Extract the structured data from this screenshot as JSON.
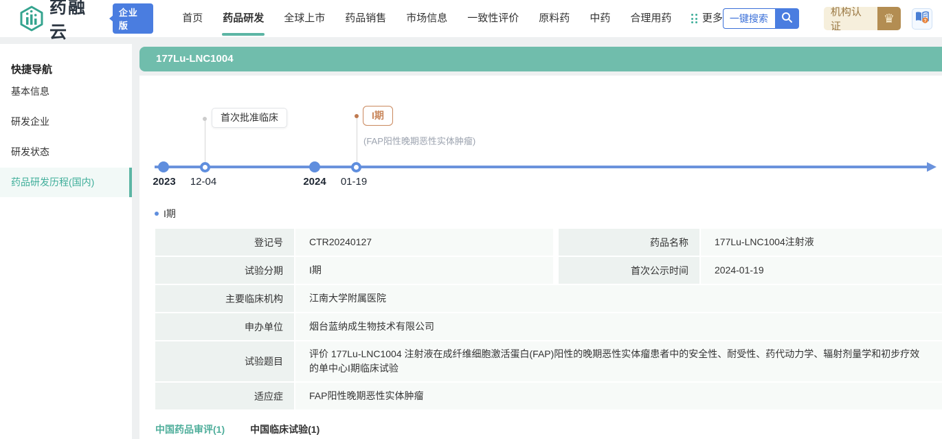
{
  "brand": {
    "name": "药融云",
    "edition": "企业版"
  },
  "nav": {
    "items": [
      {
        "label": "首页",
        "active": false
      },
      {
        "label": "药品研发",
        "active": true
      },
      {
        "label": "全球上市",
        "active": false
      },
      {
        "label": "药品销售",
        "active": false
      },
      {
        "label": "市场信息",
        "active": false
      },
      {
        "label": "一致性评价",
        "active": false
      },
      {
        "label": "原料药",
        "active": false
      },
      {
        "label": "中药",
        "active": false
      },
      {
        "label": "合理用药",
        "active": false
      }
    ],
    "more_label": "更多"
  },
  "search": {
    "placeholder": "一键搜索"
  },
  "header_right": {
    "cert_label": "机构认证"
  },
  "sidebar": {
    "title": "快捷导航",
    "items": [
      {
        "label": "基本信息",
        "active": false
      },
      {
        "label": "研发企业",
        "active": false
      },
      {
        "label": "研发状态",
        "active": false
      },
      {
        "label": "药品研发历程(国内)",
        "active": true
      }
    ]
  },
  "main": {
    "title": "177Lu-LNC1004",
    "timeline": {
      "points": [
        {
          "date": "2023",
          "type": "year"
        },
        {
          "date": "12-04",
          "type": "event"
        },
        {
          "date": "2024",
          "type": "year"
        },
        {
          "date": "01-19",
          "type": "event"
        }
      ],
      "events": [
        {
          "label": "首次批准临床"
        },
        {
          "label": "I期",
          "sublabel": "(FAP阳性晚期恶性实体肿瘤)"
        }
      ]
    },
    "section": {
      "title": "I期"
    },
    "detail_table": {
      "rows_top": [
        {
          "left_label": "登记号",
          "left_value": "CTR20240127",
          "right_label": "药品名称",
          "right_value": "177Lu-LNC1004注射液"
        },
        {
          "left_label": "试验分期",
          "left_value": "I期",
          "right_label": "首次公示时间",
          "right_value": "2024-01-19"
        }
      ],
      "rows_full": [
        {
          "label": "主要临床机构",
          "value": "江南大学附属医院"
        },
        {
          "label": "申办单位",
          "value": "烟台蓝纳成生物技术有限公司"
        },
        {
          "label": "试验题目",
          "value": "评价 177Lu-LNC1004 注射液在成纤维细胞激活蛋白(FAP)阳性的晚期恶性实体瘤患者中的安全性、耐受性、药代动力学、辐射剂量学和初步疗效的单中心I期临床试验"
        },
        {
          "label": "适应症",
          "value": "FAP阳性晚期恶性实体肿瘤"
        }
      ]
    },
    "bottom_tabs": [
      {
        "label": "中国药品审评(1)",
        "active": true
      },
      {
        "label": "中国临床试验(1)",
        "active": false
      }
    ]
  },
  "colors": {
    "brand_teal": "#5cb5a4",
    "title_bar_teal": "#70bdac",
    "timeline_blue": "#6a92dc",
    "timeline_dot_blue": "#5f8ede",
    "event_highlight_orange": "#c9875c",
    "badge_blue": "#4a7de0",
    "cert_gold": "#b38d52",
    "active_text_teal": "#3fae9a"
  }
}
